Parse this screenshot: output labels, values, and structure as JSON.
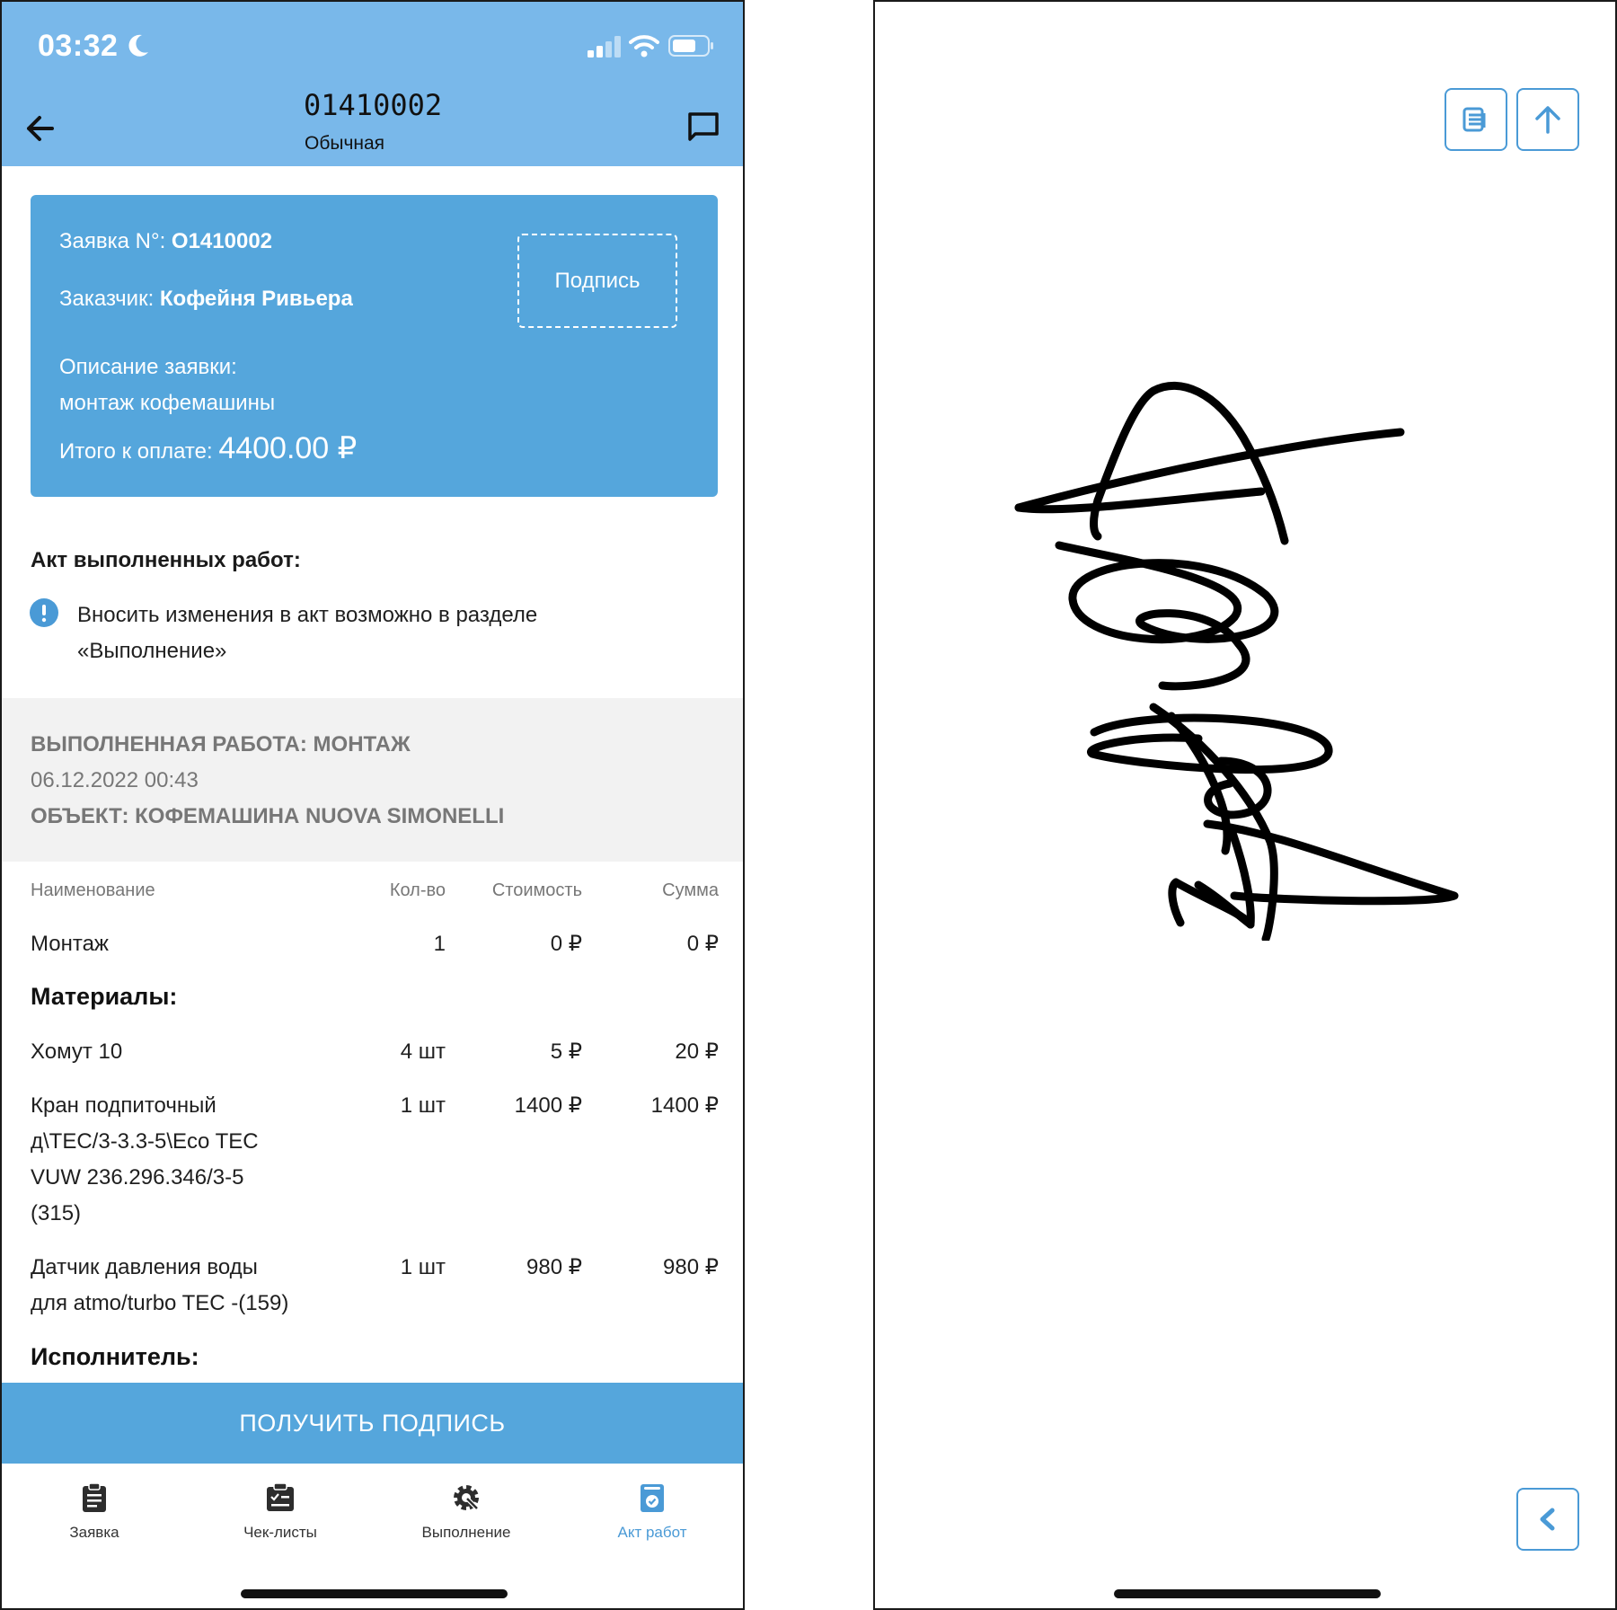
{
  "status_bar": {
    "time": "03:32"
  },
  "header": {
    "title": "01410002",
    "subtitle": "Обычная"
  },
  "card": {
    "request_label": "Заявка N°: ",
    "request_value": "O1410002",
    "customer_label": "Заказчик: ",
    "customer_value": "Кофейня Ривьера",
    "desc_label": "Описание заявки:",
    "desc_value": "монтаж кофемашины",
    "total_label": "Итого к оплате: ",
    "total_value": "4400.00 ₽",
    "sign_box_label": "Подпись"
  },
  "act": {
    "title": "Акт выполненных работ:",
    "info_line1": "Вносить изменения в акт возможно в разделе",
    "info_line2": "«Выполнение»"
  },
  "work": {
    "work_label": "ВЫПОЛНЕННАЯ РАБОТА:  МОНТАЖ",
    "date": "06.12.2022 00:43",
    "object_label": "ОБЪЕКТ:  КОФЕМАШИНА NUOVA SIMONELLI"
  },
  "table": {
    "headers": [
      "Наименование",
      "Кол-во",
      "Стоимость",
      "Сумма"
    ],
    "work_row": {
      "name": "Монтаж",
      "qty": "1",
      "price": "0  ₽",
      "sum": "0  ₽"
    },
    "materials_title": "Материалы:",
    "materials": [
      {
        "name_lines": [
          "Хомут 10"
        ],
        "qty": "4 шт",
        "price": "5  ₽",
        "sum": "20  ₽"
      },
      {
        "name_lines": [
          "Кран подпиточный",
          "д\\TEC/3-3.3-5\\Eco TEC",
          "VUW 236.296.346/3-5",
          "(315)"
        ],
        "qty": "1 шт",
        "price": "1400  ₽",
        "sum": "1400  ₽"
      },
      {
        "name_lines": [
          "Датчик давления воды",
          "для atmo/turbo TEC -(159)"
        ],
        "qty": "1 шт",
        "price": "980  ₽",
        "sum": "980  ₽"
      }
    ],
    "executor_title": "Исполнитель:"
  },
  "get_signature_button": "ПОЛУЧИТЬ ПОДПИСЬ",
  "tabs": [
    {
      "label": "Заявка",
      "icon": "clipboard-icon"
    },
    {
      "label": "Чек-листы",
      "icon": "checklist-icon"
    },
    {
      "label": "Выполнение",
      "icon": "gear-wrench-icon"
    },
    {
      "label": "Акт работ",
      "icon": "act-check-icon",
      "active": true
    }
  ],
  "colors": {
    "header_blue": "#79b8ea",
    "card_blue": "#55a6dc",
    "accent": "#4a9ad6"
  }
}
